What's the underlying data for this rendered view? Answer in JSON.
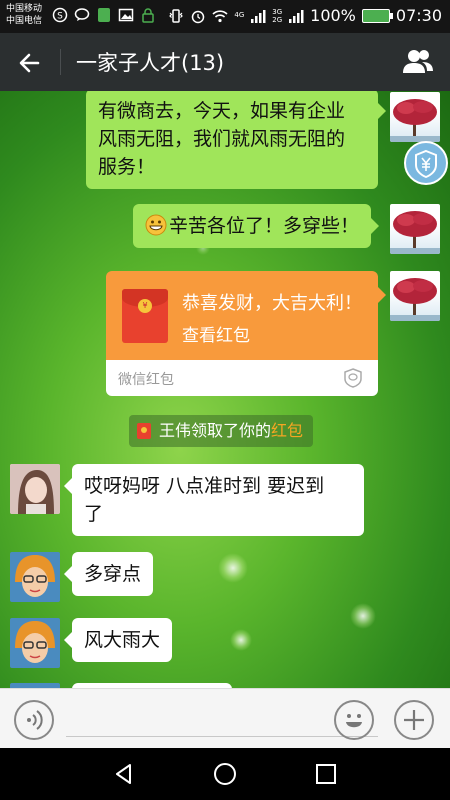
{
  "status_bar": {
    "carrier_1": "中国移动",
    "carrier_2": "中国电信",
    "battery": "100%",
    "time": "07:30",
    "net_1": "4G",
    "net_2": "3G",
    "net_3": "2G"
  },
  "header": {
    "title": "一家子人才(13)",
    "back_icon": "back-arrow-icon",
    "members_icon": "group-members-icon",
    "bg_color": "#2b2f30"
  },
  "messages": {
    "m1": {
      "line1": "有微商去，今天，如果有企业",
      "line2": "风雨无阻，我们就风雨无阻的",
      "line3": "服务！"
    },
    "m2": {
      "emoji": "grinning-face-icon",
      "text": "辛苦各位了！多穿些！"
    },
    "m3": {
      "title": "恭喜发财，大吉大利！",
      "action": "查看红包",
      "brand": "微信红包"
    },
    "notice": {
      "prefix": "王伟领取了你的",
      "link": "红包"
    },
    "m4": {
      "line1": "哎呀妈呀  八点准时到 要迟到",
      "line2": "了"
    },
    "m5": {
      "text": "多穿点"
    },
    "m6": {
      "text": "风大雨大"
    }
  },
  "colors": {
    "outgoing_bubble": "#a0e55a",
    "incoming_bubble": "#ffffff",
    "red_packet": "#f89a3c",
    "link": "#f5a623"
  },
  "input_bar": {
    "voice_icon": "voice-icon",
    "emoji_icon": "emoji-icon",
    "plus_icon": "plus-icon"
  }
}
